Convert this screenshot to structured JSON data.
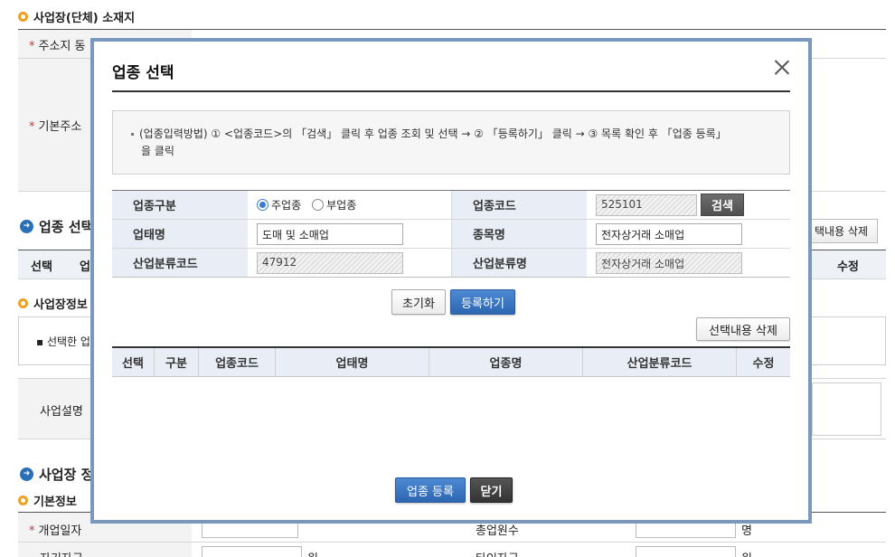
{
  "background": {
    "section_location": "사업장(단체) 소재지",
    "address_label": "주소지 동",
    "basic_address_label": "기본주소",
    "industry_section": "업종 선택",
    "col_select": "선택",
    "col_partial": "업",
    "delete_selected": "택내용 삭제",
    "col_edit": "수정",
    "biz_info": "사업장정보",
    "selected_hint": "선택한 업",
    "biz_desc": "사업설명",
    "biz_section": "사업장 정",
    "basic_info": "기본정보",
    "open_date": "개업일자",
    "total_employees": "총업원수",
    "own_capital": "자기자금",
    "other_capital": "타인자금",
    "unit_person": "명",
    "unit_won": "원"
  },
  "modal": {
    "title": "업종 선택",
    "guide_line1": "(업종입력방법) ① <업종코드>의 「검색」 클릭 후 업종 조회 및 선택 → ② 「등록하기」 클릭 → ③ 목록 확인 후 「업종 등록」",
    "guide_line2": "을 클릭",
    "form": {
      "type_label": "업종구분",
      "radio_main": "주업종",
      "radio_sub": "부업종",
      "code_label": "업종코드",
      "code_value": "525101",
      "search_button": "검색",
      "business_label": "업태명",
      "business_value": "도매 및 소매업",
      "item_label": "종목명",
      "item_value": "전자상거래 소매업",
      "ind_code_label": "산업분류코드",
      "ind_code_value": "47912",
      "ind_name_label": "산업분류명",
      "ind_name_value": "전자상거래 소매업"
    },
    "reset_button": "초기화",
    "register_button": "등록하기",
    "delete_selected_button": "선택내용 삭제",
    "columns": [
      "선택",
      "구분",
      "업종코드",
      "업태명",
      "업종명",
      "산업분류코드",
      "수정"
    ],
    "register_industry_button": "업종 등록",
    "close_button": "닫기"
  }
}
